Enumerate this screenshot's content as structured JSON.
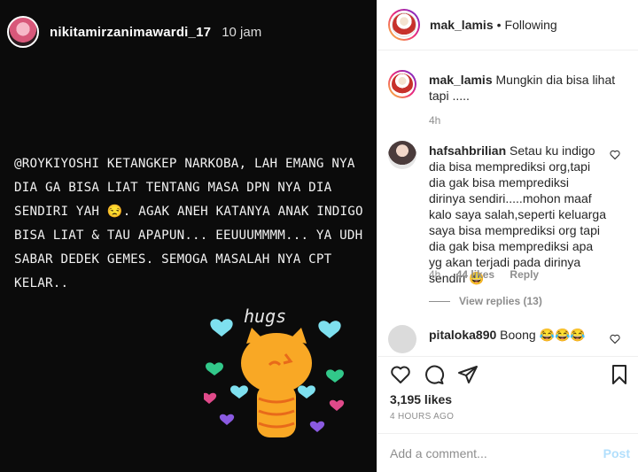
{
  "story": {
    "username": "nikitamirzanimawardi_17",
    "time": "10 jam",
    "text": "@ROYKIYOSHI KETANGKEP NARKOBA, LAH EMANG NYA DIA GA BISA LIAT TENTANG MASA DPN NYA DIA SENDIRI YAH 😒. AGAK ANEH KATANYA ANAK INDIGO BISA LIAT & TAU APAPUN... EEUUUMMMM... YA UDH SABAR DEDEK GEMES. SEMOGA MASALAH NYA CPT KELAR..",
    "sticker_text": "hugs"
  },
  "header": {
    "username": "mak_lamis",
    "separator": "•",
    "follow_status": "Following"
  },
  "caption": {
    "username": "mak_lamis",
    "text": "Mungkin dia bisa lihat tapi .....",
    "time": "4h"
  },
  "comments": [
    {
      "username": "hafsahbrilian",
      "text": "Setau ku indigo dia bisa memprediksi org,tapi dia gak bisa memprediksi dirinya sendiri.....mohon maaf kalo saya salah,seperti keluarga saya bisa memprediksi org tapi dia gak bisa memprediksi apa yg akan terjadi pada dirinya sendiri 😃",
      "time": "4h",
      "likes": "44 likes",
      "reply": "Reply",
      "view_replies": "View replies (13)"
    },
    {
      "username": "pitaloka890",
      "text": "Boong 😂😂😂"
    }
  ],
  "actions": {
    "likes": "3,195 likes",
    "posted_ago": "4 HOURS AGO",
    "comment_placeholder": "Add a comment...",
    "post_label": "Post"
  },
  "colors": {
    "link_blue": "#b2dffc",
    "muted": "#8e8e8e",
    "text": "#262626"
  }
}
